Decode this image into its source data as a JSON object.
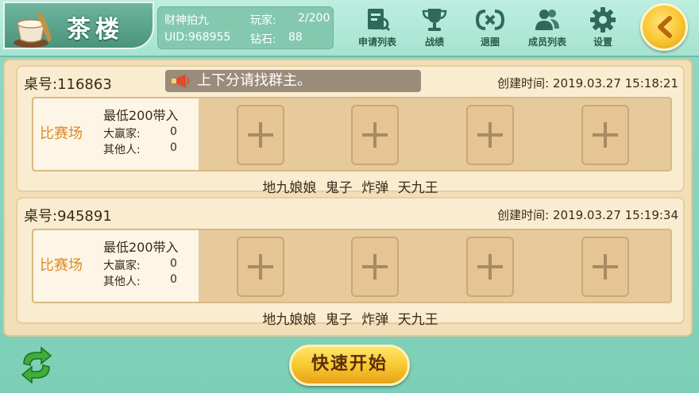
{
  "header": {
    "title": "茶楼",
    "info": {
      "group_name": "财神拍九",
      "players_label": "玩家:",
      "players_value": "2/200",
      "uid": "UID:968955",
      "diamond_label": "钻石:",
      "diamond_value": "88"
    },
    "nav": [
      {
        "label": "申请列表",
        "icon": "application-list-icon"
      },
      {
        "label": "战绩",
        "icon": "trophy-icon"
      },
      {
        "label": "退圈",
        "icon": "exit-circle-icon"
      },
      {
        "label": "成员列表",
        "icon": "members-icon"
      },
      {
        "label": "设置",
        "icon": "gear-icon"
      }
    ]
  },
  "notice": "上下分请找群主。",
  "tables": [
    {
      "number": "桌号:116863",
      "created": "创建时间: 2019.03.27 15:18:21",
      "mode": "比赛场",
      "min_buyin": "最低200带入",
      "winner_label": "大赢家:",
      "winner_value": "0",
      "others_label": "其他人:",
      "others_value": "0",
      "card_types": "地九娘娘 鬼子 炸弹 天九王"
    },
    {
      "number": "桌号:945891",
      "created": "创建时间: 2019.03.27 15:19:34",
      "mode": "比赛场",
      "min_buyin": "最低200带入",
      "winner_label": "大赢家:",
      "winner_value": "0",
      "others_label": "其他人:",
      "others_value": "0",
      "card_types": "地九娘娘 鬼子 炸弹 天九王"
    }
  ],
  "bottom": {
    "quick_start": "快速开始"
  },
  "colors": {
    "background": "#8fd9c2",
    "panel": "#f3dfb7",
    "accent_gold": "#f8c52c",
    "mode_text": "#d98a2b"
  }
}
